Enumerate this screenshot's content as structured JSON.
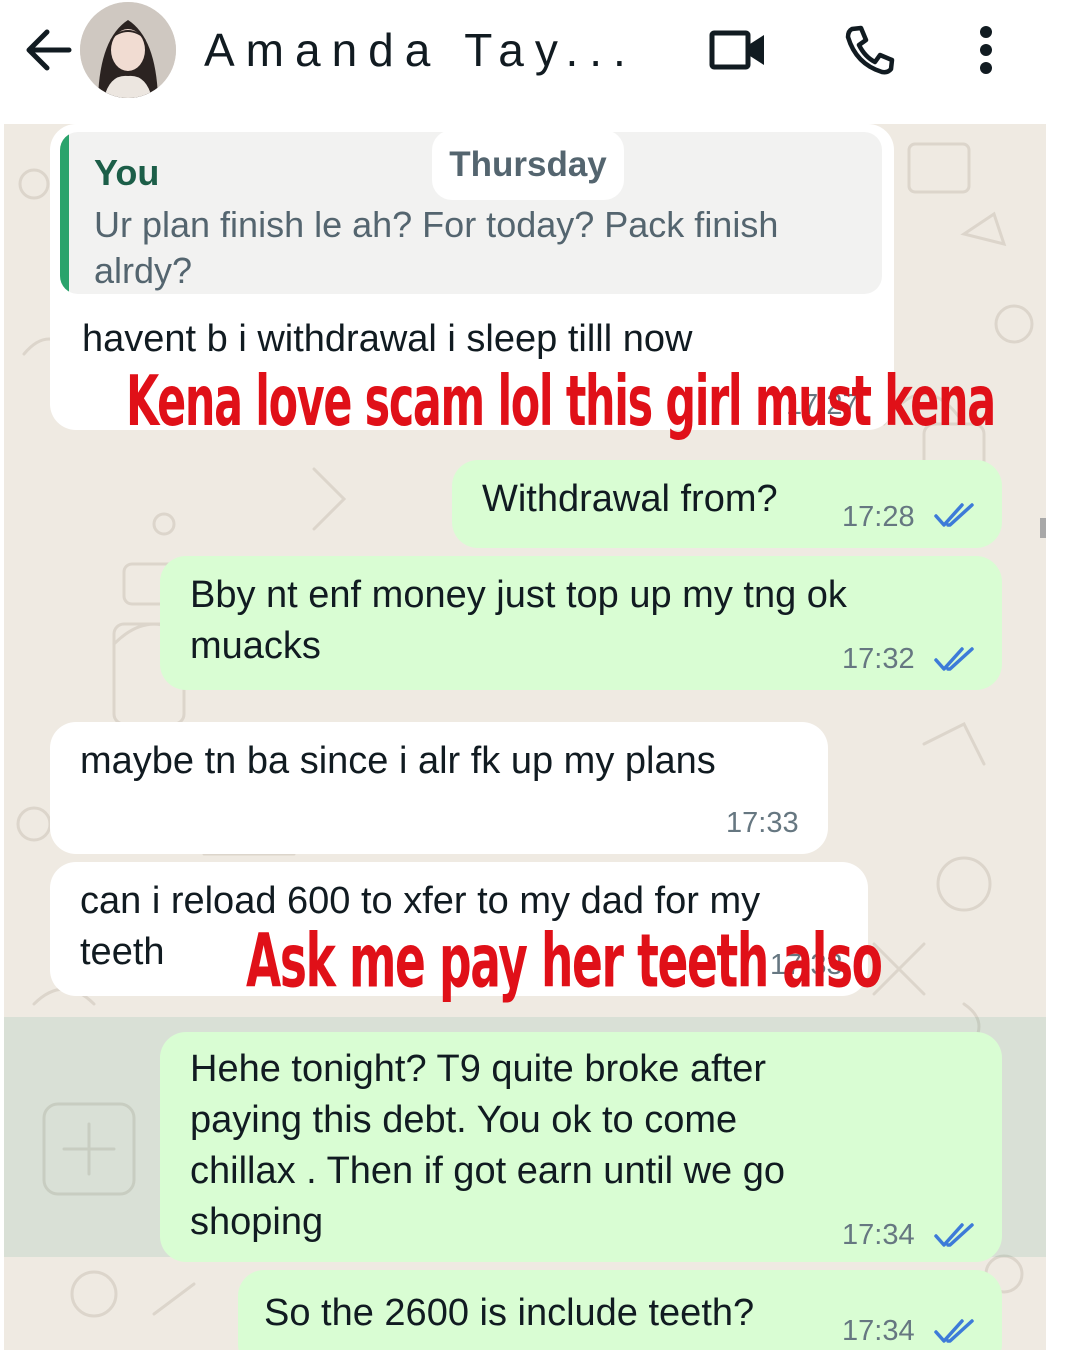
{
  "header": {
    "contact_name": "Amanda Tay...",
    "icons": {
      "back": "arrow-left-icon",
      "video": "video-camera-icon",
      "call": "phone-icon",
      "menu": "vertical-dots-icon"
    }
  },
  "date_separator": "Thursday",
  "messages": [
    {
      "direction": "in",
      "quote": {
        "author": "You",
        "text": "Ur plan finish le ah? For today? Pack finish alrdy?"
      },
      "text": "havent b i withdrawal i sleep tilll now",
      "time": "17:27"
    },
    {
      "direction": "out",
      "text": "Withdrawal from?",
      "time": "17:28",
      "status": "read"
    },
    {
      "direction": "out",
      "text_lines": [
        "Bby nt enf money just top up my tng ok",
        "muacks"
      ],
      "time": "17:32",
      "status": "read"
    },
    {
      "direction": "in",
      "text": "maybe tn ba since i alr fk up my plans",
      "time": "17:33"
    },
    {
      "direction": "in",
      "text_lines": [
        "can i reload 600 to xfer to my dad for my",
        "teeth"
      ],
      "time": "17:33"
    },
    {
      "direction": "out",
      "text_lines": [
        "Hehe tonight? T9 quite broke after",
        "paying this debt. You ok to come",
        "chillax . Then if got earn until we go",
        "shoping"
      ],
      "time": "17:34",
      "status": "read"
    },
    {
      "direction": "out",
      "text": "So the 2600 is include teeth?",
      "time": "17:34",
      "status": "read"
    }
  ],
  "captions": [
    "Kena love scam lol this girl must kena",
    "Ask me pay her teeth also"
  ],
  "colors": {
    "incoming_bubble": "#ffffff",
    "outgoing_bubble": "#d9fdd3",
    "chat_background": "#efeae2",
    "read_ticks": "#3d7bd8",
    "caption_red": "#e01018",
    "quote_bar": "#2aa36c"
  }
}
